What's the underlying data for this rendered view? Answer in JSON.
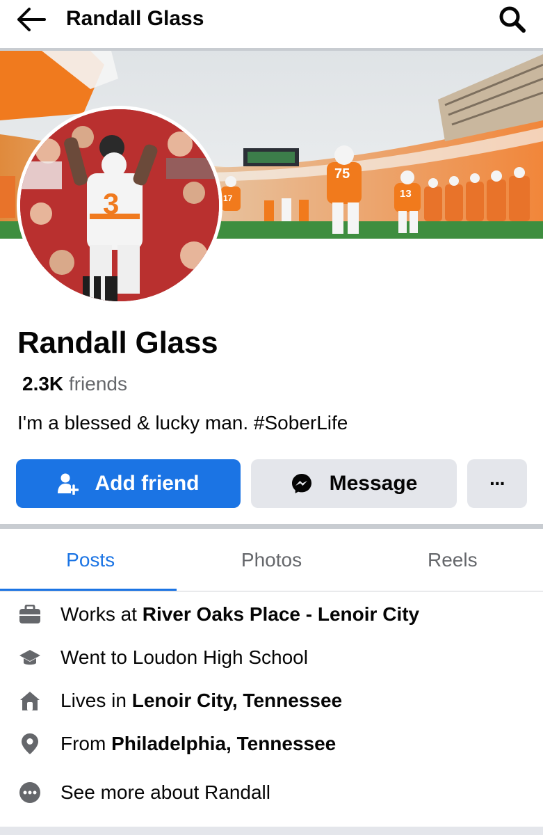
{
  "header": {
    "title": "Randall Glass"
  },
  "cover": {
    "scoreboard_text": "",
    "jersey_number_1": "75",
    "jersey_number_2": "13",
    "jersey_number_3": "17",
    "accent_color": "#f77f00"
  },
  "avatar": {
    "jersey_number": "3"
  },
  "profile": {
    "name": "Randall Glass",
    "friends_count": "2.3K",
    "friends_label": "friends",
    "bio": "I'm a blessed & lucky man. #SoberLife"
  },
  "actions": {
    "add_friend_label": "Add friend",
    "message_label": "Message",
    "more_label": "···"
  },
  "tabs": [
    {
      "label": "Posts",
      "active": true
    },
    {
      "label": "Photos",
      "active": false
    },
    {
      "label": "Reels",
      "active": false
    }
  ],
  "details": {
    "work_prefix": "Works at ",
    "work_value": "River Oaks Place - Lenoir City",
    "education": "Went to Loudon High School",
    "lives_prefix": "Lives in ",
    "lives_value": "Lenoir City, Tennessee",
    "from_prefix": "From ",
    "from_value": "Philadelphia, Tennessee",
    "see_more": "See more about Randall"
  },
  "icons": {
    "back": "arrow-left-icon",
    "search": "search-icon",
    "add_friend": "add-friend-icon",
    "message": "messenger-icon",
    "more": "more-dots-icon",
    "work": "briefcase-icon",
    "education": "graduation-cap-icon",
    "home": "home-icon",
    "location": "location-pin-icon",
    "see_more": "more-circle-icon"
  },
  "colors": {
    "primary_blue": "#1b74e4",
    "secondary_gray": "#e4e6eb",
    "muted_text": "#65676b",
    "text": "#050505"
  }
}
